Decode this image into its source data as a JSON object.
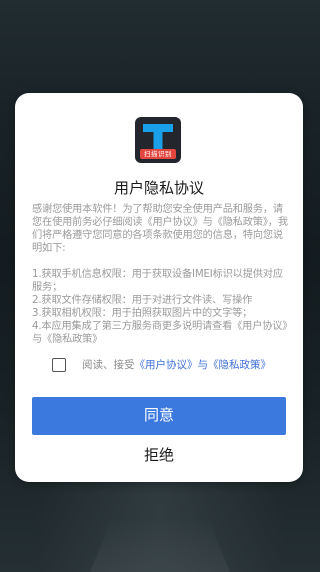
{
  "app": {
    "logo_tag": "扫描识别",
    "logo_icon": "text-t-icon"
  },
  "dialog": {
    "title": "用户隐私协议",
    "intro": "感谢您使用本软件！为了帮助您安全使用产品和服务，请您在使用前务必仔细阅读《用户协议》与《隐私政策》，我们将严格遵守您同意的各项条款使用您的信息，特向您说明如下:",
    "items": [
      "1.获取手机信息权限：用于获取设备IMEI标识以提供对应服务；",
      "2.获取文件存储权限：用于对进行文件读、写操作",
      "3.获取相机权限：用于拍照获取图片中的文字等；",
      "4.本应用集成了第三方服务商更多说明请查看《用户协议》与《隐私政策》"
    ],
    "agree_prefix": "阅读、接受",
    "user_agreement_link": "《用户协议》",
    "and_text": "与",
    "privacy_policy_link": "《隐私政策》",
    "checkbox_checked": false,
    "agree_button": "同意",
    "refuse_button": "拒绝"
  },
  "colors": {
    "accent": "#3c79de",
    "link": "#3f6fd8",
    "logo_tag": "#e2463f",
    "logo_bg": "#23272d",
    "logo_t": "#1aa0e8"
  }
}
